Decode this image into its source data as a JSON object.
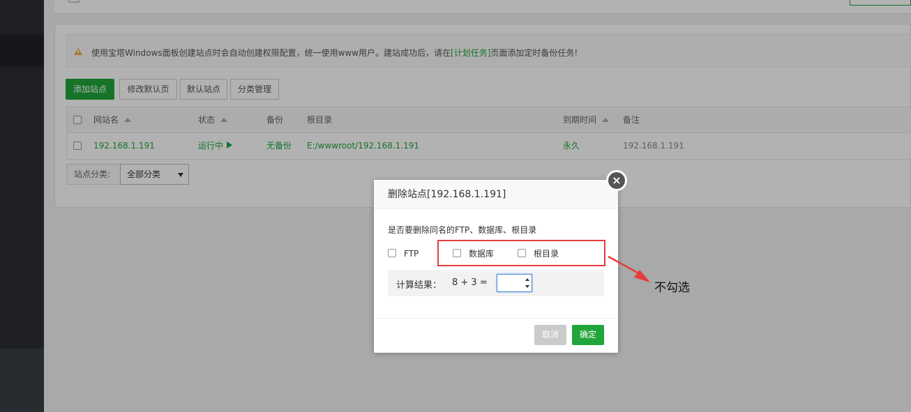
{
  "notice": {
    "text_before": "使用宝塔Windows面板创建站点时会自动创建权限配置，统一使用www用户。建站成功后，请在",
    "link": "[计划任务]",
    "text_after": "页面添加定时备份任务!"
  },
  "toolbar": {
    "add_site": "添加站点",
    "modify_default_page": "修改默认页",
    "default_site": "默认站点",
    "category_management": "分类管理"
  },
  "table": {
    "headers": {
      "site_name": "网站名",
      "status": "状态",
      "backup": "备份",
      "root_dir": "根目录",
      "expire_time": "到期时间",
      "remark": "备注"
    },
    "rows": [
      {
        "site_name": "192.168.1.191",
        "status": "运行中",
        "backup": "无备份",
        "root_dir": "E:/wwwroot/192.168.1.191",
        "expire_time": "永久",
        "remark": "192.168.1.191"
      }
    ]
  },
  "category_filter": {
    "label": "站点分类:",
    "selected": "全部分类"
  },
  "dialog": {
    "title": "删除站点[192.168.1.191]",
    "question": "是否要删除同名的FTP、数据库、根目录",
    "options": [
      {
        "label": "FTP",
        "checked": false
      },
      {
        "label": "数据库",
        "checked": false
      },
      {
        "label": "根目录",
        "checked": false
      }
    ],
    "calc_label": "计算结果：",
    "calc_expression": "8 + 3  =",
    "calc_value": "",
    "cancel": "取消",
    "confirm": "确定"
  },
  "annotation": {
    "text": "不勾选",
    "color": "#e53c3c"
  },
  "colors": {
    "accent_green": "#20a53a",
    "sidebar_dark": "#2b2f36",
    "warning": "#f0ad4e"
  }
}
